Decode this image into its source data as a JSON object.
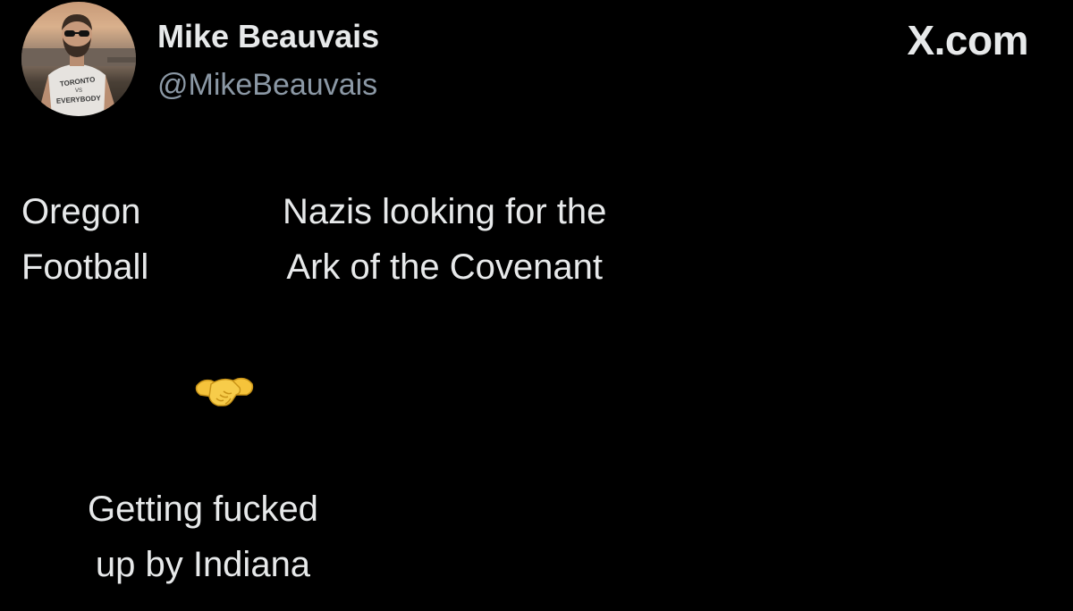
{
  "author": {
    "display_name": "Mike Beauvais",
    "handle": "@MikeBeauvais",
    "avatar_shirt_text": [
      "TORONTO",
      "VS",
      "EVERYBODY"
    ]
  },
  "brand": {
    "label": "X.com"
  },
  "meme": {
    "left_label": [
      "Oregon",
      "Football"
    ],
    "right_label": [
      "Nazis looking for the",
      "Ark of the Covenant"
    ],
    "center_icon": "handshake-icon",
    "bottom_label": [
      "Getting fucked",
      "up by Indiana"
    ]
  },
  "colors": {
    "background": "#000000",
    "primary_text": "#e7e9ea",
    "secondary_text": "#8b98a5",
    "handshake": "#f5c33b"
  }
}
